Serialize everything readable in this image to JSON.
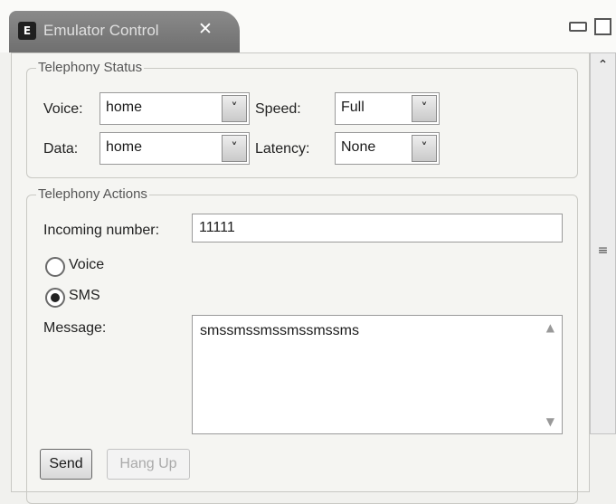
{
  "tab": {
    "app_icon": "E",
    "title": "Emulator Control",
    "close_glyph": "✕"
  },
  "window_controls": {
    "minimize": "minimize-icon",
    "maximize": "maximize-icon"
  },
  "telephony_status": {
    "title": "Telephony Status",
    "voice_label": "Voice:",
    "voice_value": "home",
    "speed_label": "Speed:",
    "speed_value": "Full",
    "data_label": "Data:",
    "data_value": "home",
    "latency_label": "Latency:",
    "latency_value": "None"
  },
  "telephony_actions": {
    "title": "Telephony Actions",
    "incoming_label": "Incoming number:",
    "incoming_value": "11111",
    "voice_radio_label": "Voice",
    "sms_radio_label": "SMS",
    "selected": "SMS",
    "message_label": "Message:",
    "message_value": "smssmssmssmssmssms",
    "send_label": "Send",
    "hangup_label": "Hang Up"
  },
  "scrollbar": {
    "up_glyph": "⌃",
    "grip_glyph": "≡"
  }
}
